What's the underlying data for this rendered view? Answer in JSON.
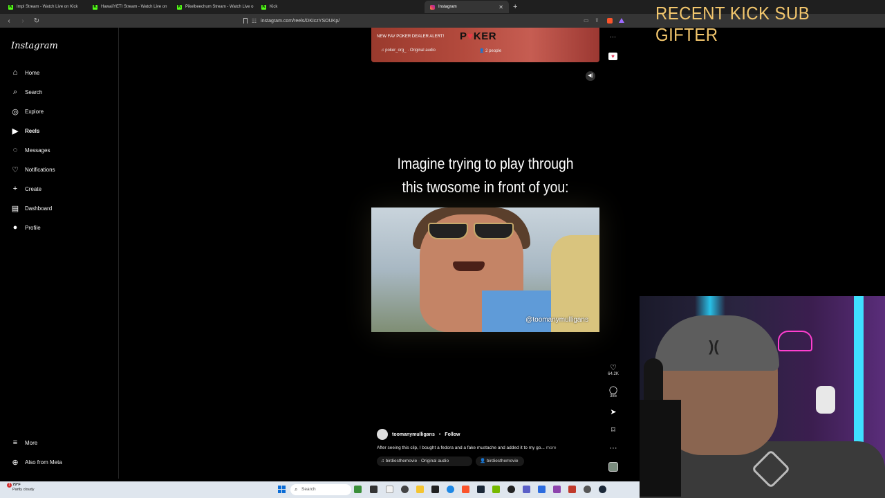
{
  "browser": {
    "tabs": [
      {
        "title": "Impl Stream - Watch Live on Kick",
        "favicon": "kick",
        "active": false
      },
      {
        "title": "HawaiiYETI Stream - Watch Live on",
        "favicon": "kick",
        "active": false
      },
      {
        "title": "Pikelbeechum Stream - Watch Live o",
        "favicon": "kick",
        "active": false
      },
      {
        "title": "Kick",
        "favicon": "kick",
        "active": false
      },
      {
        "title": "Instagram",
        "favicon": "instagram",
        "active": true
      }
    ],
    "url": "instagram.com/reels/DKIczYSOUKp/"
  },
  "instagram": {
    "logo": "Instagram",
    "nav": [
      {
        "label": "Home",
        "icon": "home-icon"
      },
      {
        "label": "Search",
        "icon": "search-icon"
      },
      {
        "label": "Explore",
        "icon": "compass-icon"
      },
      {
        "label": "Reels",
        "icon": "reels-icon",
        "active": true
      },
      {
        "label": "Messages",
        "icon": "messenger-icon"
      },
      {
        "label": "Notifications",
        "icon": "heart-icon"
      },
      {
        "label": "Create",
        "icon": "plus-icon"
      },
      {
        "label": "Dashboard",
        "icon": "chart-icon"
      },
      {
        "label": "Profile",
        "icon": "avatar-icon"
      }
    ],
    "more": "More",
    "also_from_meta": "Also from Meta",
    "prev_reel": {
      "caption": "NEW FAV POKER DEALER ALERT!",
      "logo_text": "POKER",
      "audio": "poker_org_ · Original audio",
      "people": "2 people"
    },
    "reel": {
      "overlay_line1": "Imagine trying to play through",
      "overlay_line2": "this twosome in front of you:",
      "watermark": "@toomanymulligans",
      "likes": "64.2K",
      "comments": "385",
      "author": "toomanymulligans",
      "separator": "•",
      "follow": "Follow",
      "caption": "After seeing this clip, I bought a fedora and a fake mustache and added it to my go...",
      "caption_more": "more",
      "audio": "birdiesthemovie · Original audio",
      "tagged": "birdiesthemovie"
    }
  },
  "stream_overlay": {
    "title": "RECENT KICK SUB GIFTER",
    "color": "#f2c66d"
  },
  "taskbar": {
    "weather_temp": "79°F",
    "weather_desc": "Partly cloudy",
    "weather_badge": "1",
    "search_placeholder": "Search"
  }
}
